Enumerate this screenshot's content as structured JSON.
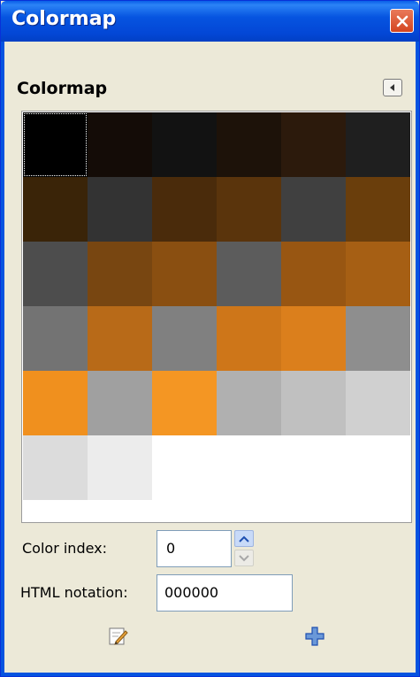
{
  "window": {
    "title": "Colormap",
    "close_icon": "close-icon"
  },
  "panel": {
    "header": "Colormap",
    "menu_icon": "triangle-left-icon"
  },
  "colormap": {
    "selected_index": 0,
    "colors": [
      "#000000",
      "#140c07",
      "#121212",
      "#1d1209",
      "#2c1a0c",
      "#1f1f1f",
      "#3a2408",
      "#333333",
      "#4a2b0b",
      "#5a340c",
      "#404040",
      "#6a3e0c",
      "#4d4d4d",
      "#784611",
      "#8a4f11",
      "#5c5c5c",
      "#985612",
      "#a65f14",
      "#737373",
      "#b86a18",
      "#808080",
      "#ce7619",
      "#db7f1c",
      "#8e8e8e",
      "#f0901e",
      "#a0a0a0",
      "#f49623",
      "#b0b0b0",
      "#c0c0c0",
      "#d0d0d0",
      "#dcdcdc",
      "#ececec"
    ]
  },
  "color_index": {
    "label": "Color index:",
    "value": "0"
  },
  "html_notation": {
    "label": "HTML notation:",
    "value": "000000"
  },
  "actions": {
    "edit_icon": "pencil-edit-icon",
    "add_icon": "plus-add-icon"
  }
}
